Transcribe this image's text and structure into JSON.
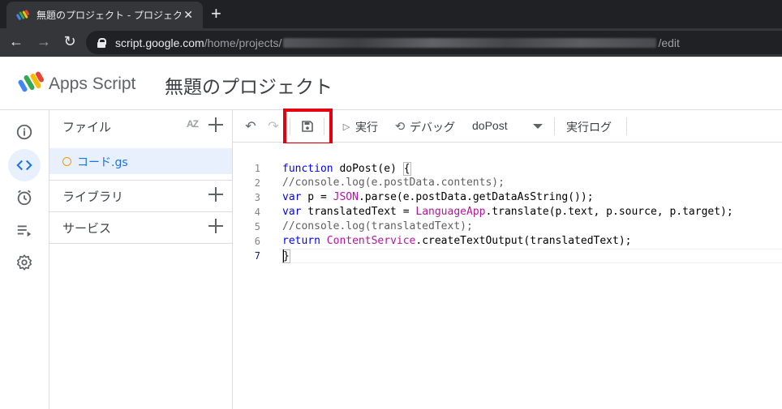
{
  "browser": {
    "tab_title": "無題のプロジェクト - プロジェクト編集",
    "url_host": "script.google.com",
    "url_path_prefix": "/home/projects/",
    "url_path_suffix": "/edit"
  },
  "app": {
    "brand": "Apps Script",
    "project_title": "無題のプロジェクト"
  },
  "files_panel": {
    "files_label": "ファイル",
    "sort_label": "AZ",
    "file_name": "コード.gs",
    "libraries_label": "ライブラリ",
    "services_label": "サービス"
  },
  "toolbar": {
    "run_label": "実行",
    "debug_label": "デバッグ",
    "function_select": "doPost",
    "log_label": "実行ログ"
  },
  "editor": {
    "line_numbers": [
      "1",
      "2",
      "3",
      "4",
      "5",
      "6",
      "7"
    ],
    "lines": {
      "l1": [
        "function",
        " doPost(e) ",
        "{"
      ],
      "l2": [
        "//console.log(e.postData.contents);"
      ],
      "l3": [
        "var",
        " p = ",
        "JSON",
        ".parse(e.postData.getDataAsString());"
      ],
      "l4": [
        "var",
        " translatedText = ",
        "LanguageApp",
        ".translate(p.text, p.source, p.target);"
      ],
      "l5": [
        "//console.log(translatedText);"
      ],
      "l6": [
        "return",
        " ",
        "ContentService",
        ".createTextOutput(translatedText);"
      ],
      "l7": [
        "}"
      ]
    }
  },
  "colors": {
    "keyword": "#0000ff",
    "type": "#b5139f",
    "comment": "#5f5f5f",
    "highlight_box": "#e4000f",
    "active_blue": "#1a73e8"
  },
  "icons": {
    "rail": [
      "info-icon",
      "code-icon",
      "clock-icon",
      "executions-icon",
      "settings-icon"
    ],
    "toolbar": [
      "undo-icon",
      "redo-icon",
      "save-icon",
      "play-icon",
      "debug-icon",
      "chevron-down-icon"
    ]
  }
}
